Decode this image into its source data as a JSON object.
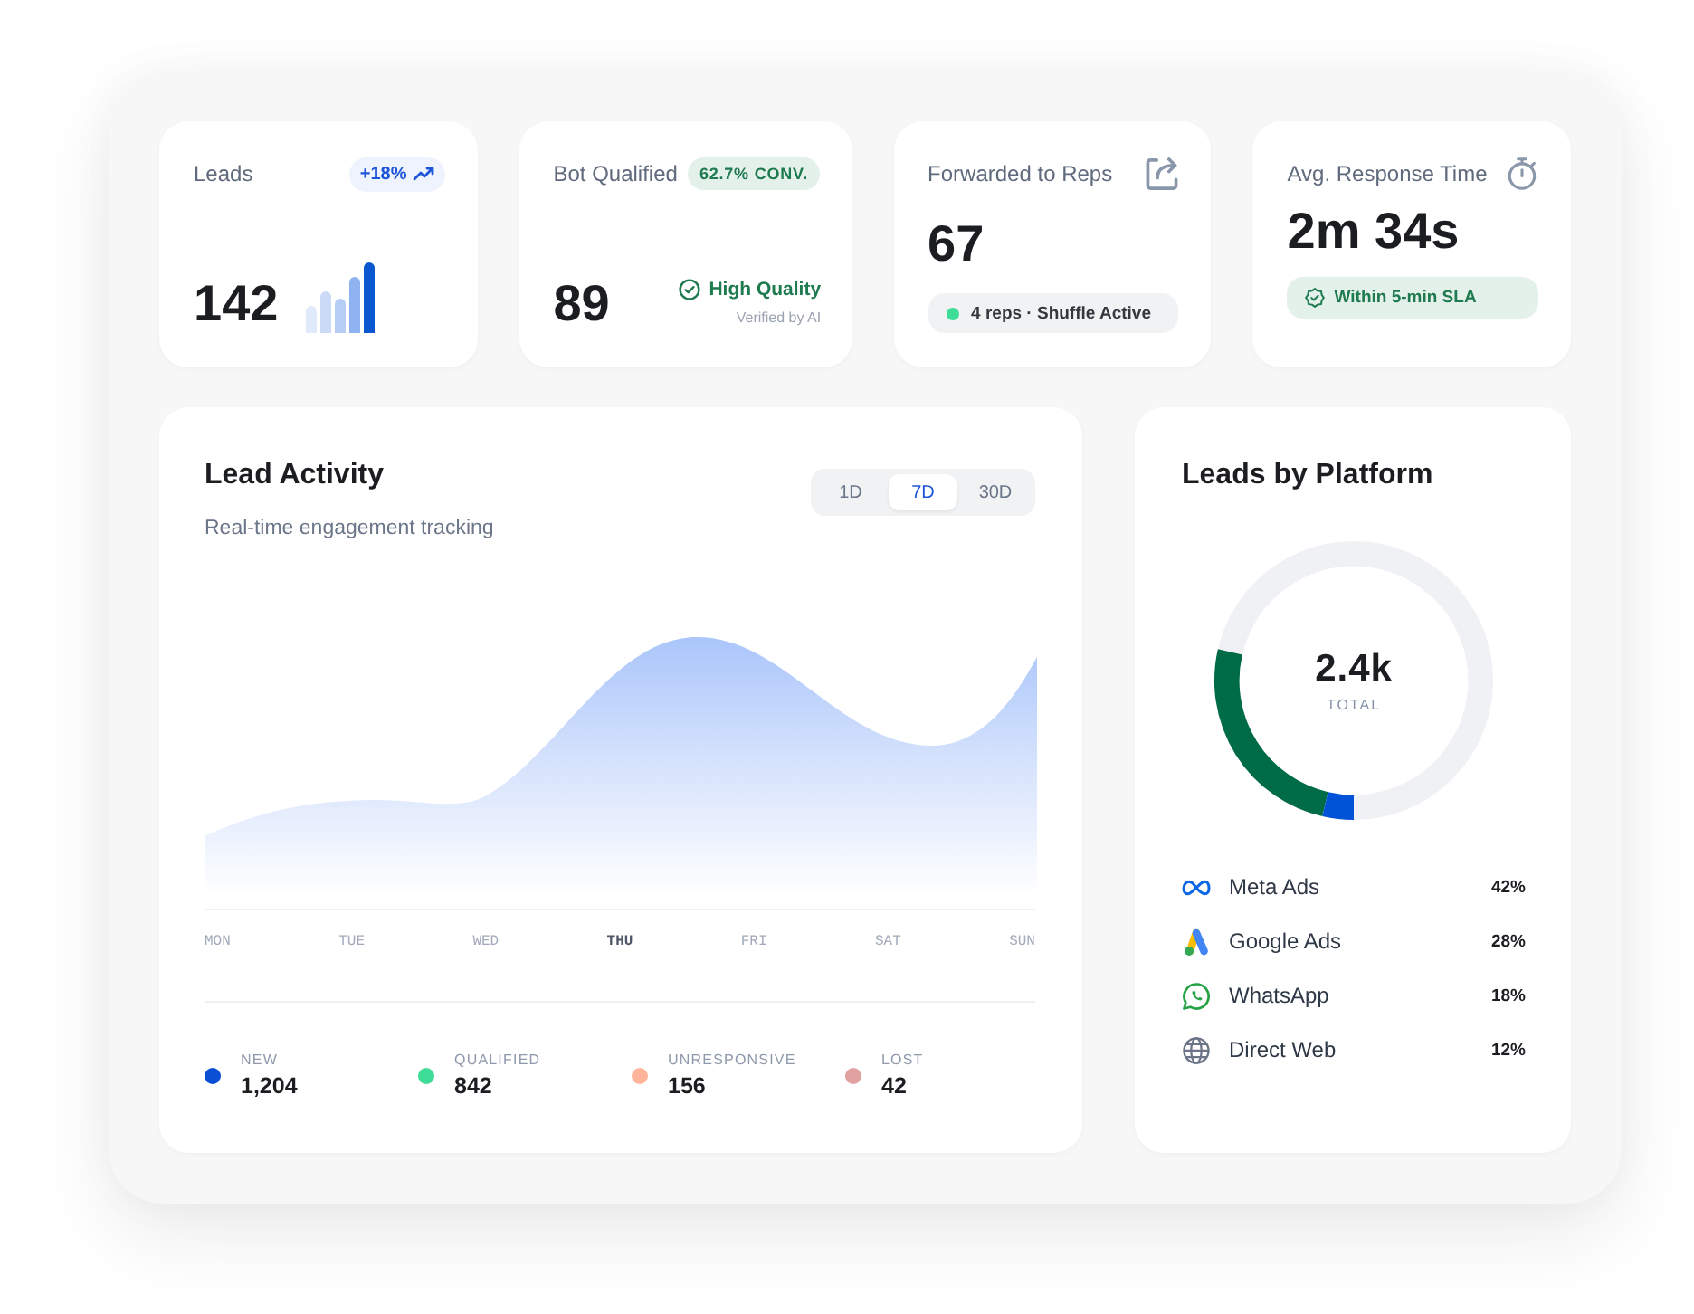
{
  "stats": [
    {
      "kind": "bars",
      "label": "Leads",
      "badge": "+18%",
      "value": "142"
    },
    {
      "kind": "quality",
      "label": "Bot Qualified",
      "badge": "62.7% CONV.",
      "value": "89",
      "status": "High Quality",
      "note": "Verified by AI"
    },
    {
      "kind": "pill",
      "label": "Forwarded to Reps",
      "value": "67",
      "pill": "4 reps · Shuffle Active"
    },
    {
      "kind": "sla",
      "label": "Avg. Response Time",
      "value": "2m 34s",
      "pill": "Within 5-min SLA"
    }
  ],
  "activity": {
    "title": "Lead Activity",
    "subtitle": "Real-time engagement tracking",
    "ranges": [
      {
        "label": "1D",
        "selected": false
      },
      {
        "label": "7D",
        "selected": true
      },
      {
        "label": "30D",
        "selected": false
      }
    ],
    "days": [
      {
        "label": "MON",
        "current": false
      },
      {
        "label": "TUE",
        "current": false
      },
      {
        "label": "WED",
        "current": false
      },
      {
        "label": "THU",
        "current": true
      },
      {
        "label": "FRI",
        "current": false
      },
      {
        "label": "SAT",
        "current": false
      },
      {
        "label": "SUN",
        "current": false
      }
    ],
    "legend": [
      {
        "label": "NEW",
        "value": "1,204",
        "color": "#0b50d4"
      },
      {
        "label": "QUALIFIED",
        "value": "842",
        "color": "#3ddc97"
      },
      {
        "label": "UNRESPONSIVE",
        "value": "156",
        "color": "#ffb49a"
      },
      {
        "label": "LOST",
        "value": "42",
        "color": "#e2a1a1"
      }
    ]
  },
  "platforms": {
    "title": "Leads by Platform",
    "total": "2.4k",
    "total_label": "TOTAL",
    "items": [
      {
        "name": "Meta Ads",
        "share": "42%"
      },
      {
        "name": "Google Ads",
        "share": "28%"
      },
      {
        "name": "WhatsApp",
        "share": "18%"
      },
      {
        "name": "Direct Web",
        "share": "12%"
      }
    ]
  }
}
